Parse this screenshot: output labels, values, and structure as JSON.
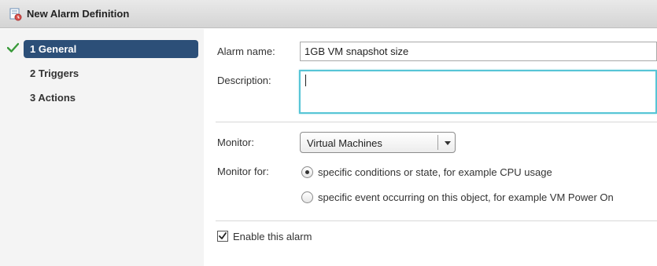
{
  "window": {
    "title": "New Alarm Definition",
    "icon": "alarm-definition-icon"
  },
  "wizard": {
    "completed_icon": "checkmark-icon",
    "steps": [
      {
        "label": "1 General",
        "active": true,
        "completed": true
      },
      {
        "label": "2 Triggers",
        "active": false,
        "completed": false
      },
      {
        "label": "3 Actions",
        "active": false,
        "completed": false
      }
    ]
  },
  "form": {
    "alarm_name": {
      "label": "Alarm name:",
      "value": "1GB VM snapshot size"
    },
    "description": {
      "label": "Description:",
      "value": ""
    },
    "monitor": {
      "label": "Monitor:",
      "selected": "Virtual Machines"
    },
    "monitor_for": {
      "label": "Monitor for:",
      "options": [
        {
          "label": "specific conditions or state, for example CPU usage",
          "selected": true
        },
        {
          "label": "specific event occurring on this object, for example VM Power On",
          "selected": false
        }
      ]
    },
    "enable": {
      "label": "Enable this alarm",
      "checked": true
    }
  },
  "colors": {
    "active_step_bg": "#2c4f78",
    "focus_border": "#57c5d6",
    "check_green": "#3a9a3a"
  }
}
